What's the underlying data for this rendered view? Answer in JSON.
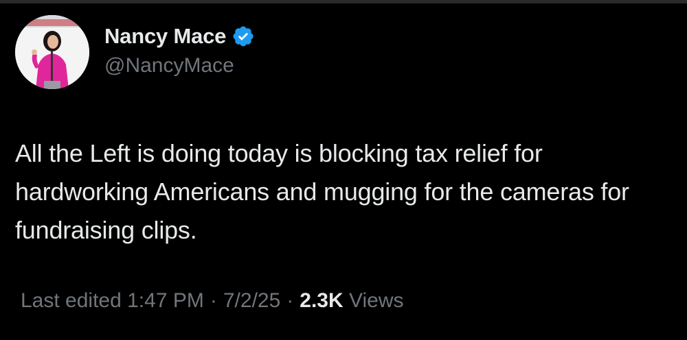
{
  "author": {
    "display_name": "Nancy Mace",
    "handle": "@NancyMace",
    "verified": true,
    "verified_color": "#1d9bf0",
    "avatar_icon": "profile-photo"
  },
  "tweet": {
    "text": "All the Left is doing today is blocking tax relief for hardworking Americans and mugging for the cameras for fundraising clips."
  },
  "meta": {
    "edited_label": "Last edited",
    "time": "1:47 PM",
    "separator": "·",
    "date": "7/2/25",
    "views_count": "2.3K",
    "views_label": "Views"
  },
  "colors": {
    "background": "#000000",
    "primary_text": "#e7e9ea",
    "secondary_text": "#71767b",
    "accent": "#1d9bf0"
  }
}
